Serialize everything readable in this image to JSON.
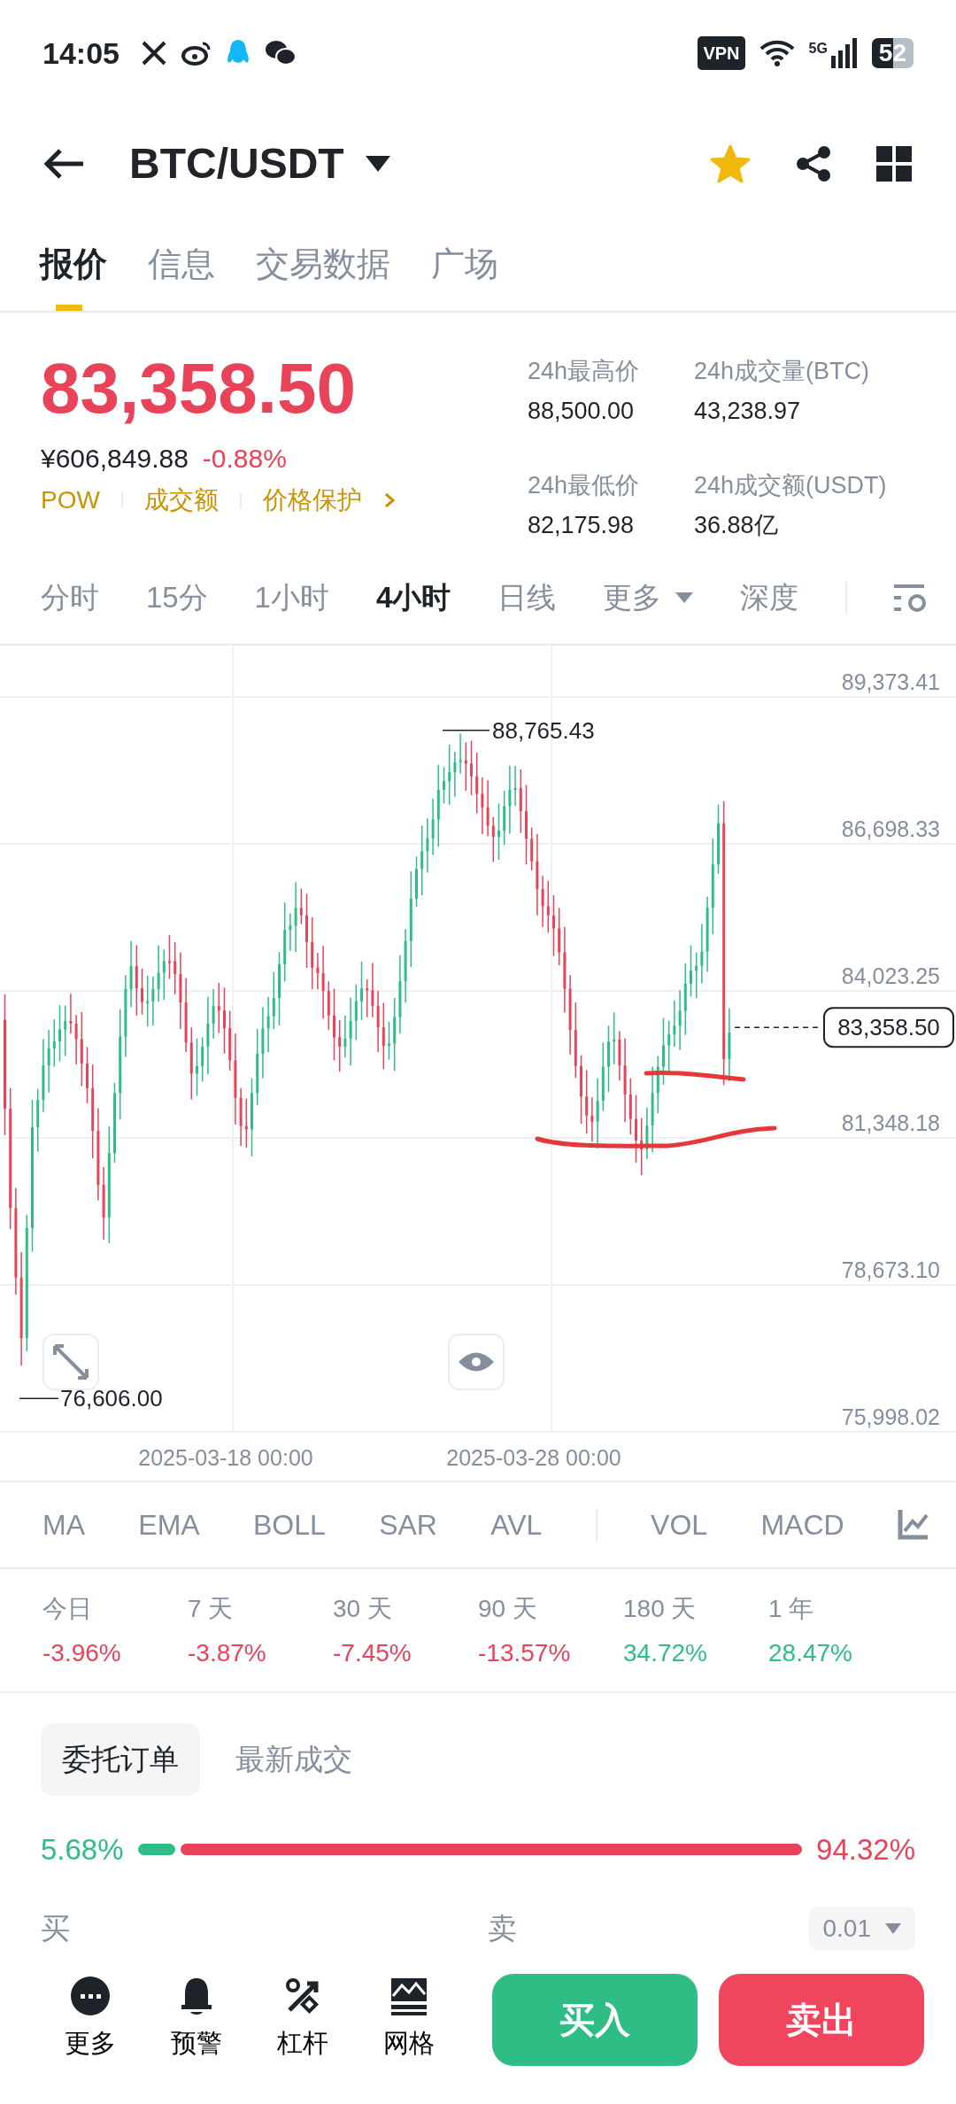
{
  "status_bar": {
    "time": "14:05",
    "vpn": "VPN",
    "network": "5G",
    "battery": "52"
  },
  "header": {
    "pair": "BTC/USDT",
    "favorite": true
  },
  "tabs": [
    {
      "label": "报价",
      "selected": true
    },
    {
      "label": "信息",
      "selected": false
    },
    {
      "label": "交易数据",
      "selected": false
    },
    {
      "label": "广场",
      "selected": false
    }
  ],
  "price": {
    "last": "83,358.50",
    "cny": "¥606,849.88",
    "change": "-0.88%",
    "tags": [
      "POW",
      "成交额",
      "价格保护"
    ]
  },
  "stats": [
    {
      "label": "24h最高价",
      "value": "88,500.00"
    },
    {
      "label": "24h成交量(BTC)",
      "value": "43,238.97"
    },
    {
      "label": "24h最低价",
      "value": "82,175.98"
    },
    {
      "label": "24h成交额(USDT)",
      "value": "36.88亿"
    }
  ],
  "intervals": [
    {
      "label": "分时",
      "selected": false,
      "dropdown": false
    },
    {
      "label": "15分",
      "selected": false,
      "dropdown": false
    },
    {
      "label": "1小时",
      "selected": false,
      "dropdown": false
    },
    {
      "label": "4小时",
      "selected": true,
      "dropdown": false
    },
    {
      "label": "日线",
      "selected": false,
      "dropdown": false
    },
    {
      "label": "更多",
      "selected": false,
      "dropdown": true
    },
    {
      "label": "深度",
      "selected": false,
      "dropdown": false
    }
  ],
  "chart": {
    "y_axis_labels": [
      "89,373.41",
      "86,698.33",
      "84,023.25",
      "81,348.18",
      "78,673.10",
      "75,998.02"
    ],
    "x_axis_labels": [
      "2025-03-18 00:00",
      "2025-03-28 00:00"
    ],
    "high_label": "88,765.43",
    "low_label": "76,606.00",
    "last_price": "83,358.50"
  },
  "indicators": [
    "MA",
    "EMA",
    "BOLL",
    "SAR",
    "AVL",
    "VOL",
    "MACD"
  ],
  "performance": [
    {
      "period": "今日",
      "change": "-3.96%",
      "color": "#e94359"
    },
    {
      "period": "7 天",
      "change": "-3.87%",
      "color": "#e94359"
    },
    {
      "period": "30 天",
      "change": "-7.45%",
      "color": "#e94359"
    },
    {
      "period": "90 天",
      "change": "-13.57%",
      "color": "#e94359"
    },
    {
      "period": "180 天",
      "change": "34.72%",
      "color": "#2ebd85"
    },
    {
      "period": "1 年",
      "change": "28.47%",
      "color": "#2ebd85"
    }
  ],
  "book_tabs": [
    {
      "label": "委托订单",
      "selected": true
    },
    {
      "label": "最新成交",
      "selected": false
    }
  ],
  "ratio": {
    "buy": "5.68%",
    "sell": "94.32%",
    "level": 0.0568
  },
  "book_header": {
    "buy": "买",
    "sell": "卖",
    "precision": "0.01"
  },
  "bottom_actions": [
    {
      "label": "更多",
      "kind": "more"
    },
    {
      "label": "预警",
      "kind": "alert"
    },
    {
      "label": "杠杆",
      "kind": "leverage"
    },
    {
      "label": "网格",
      "kind": "grid"
    }
  ],
  "trade_buttons": [
    {
      "label": "买入",
      "color": "#2ebd85"
    },
    {
      "label": "卖出",
      "color": "#f0465d"
    }
  ]
}
